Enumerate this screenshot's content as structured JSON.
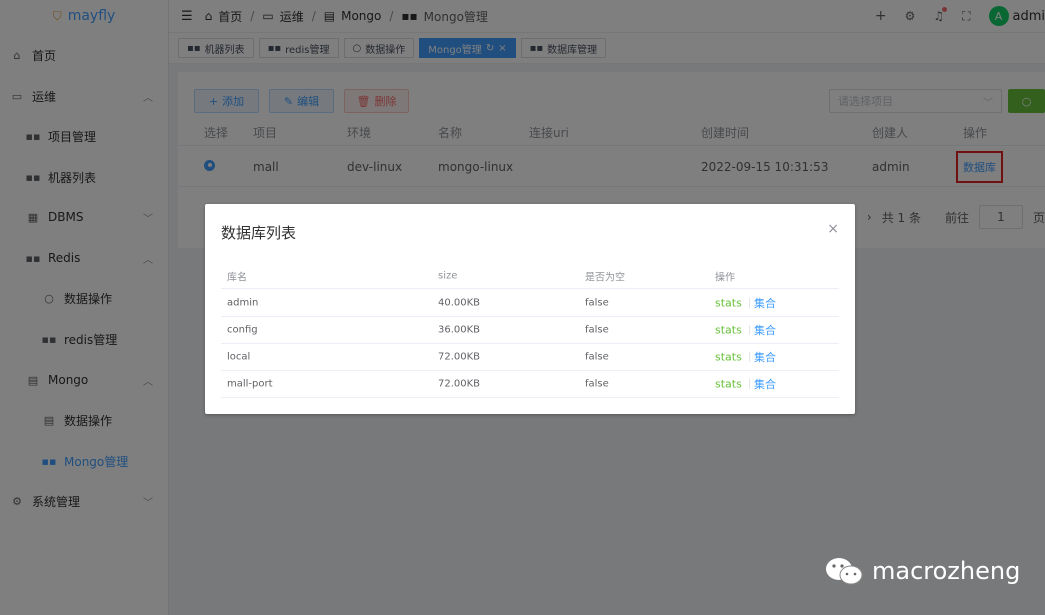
{
  "app": {
    "name": "mayfly"
  },
  "sidebar": {
    "items": [
      {
        "label": "首页",
        "icon": "home-icon"
      },
      {
        "label": "运维",
        "icon": "monitor-icon"
      },
      {
        "label": "项目管理",
        "icon": "grid-icon"
      },
      {
        "label": "机器列表",
        "icon": "grid-icon"
      },
      {
        "label": "DBMS",
        "icon": "table-icon"
      },
      {
        "label": "Redis",
        "icon": "grid-icon"
      },
      {
        "label": "数据操作",
        "icon": "search-icon"
      },
      {
        "label": "redis管理",
        "icon": "grid-icon"
      },
      {
        "label": "Mongo",
        "icon": "document-icon"
      },
      {
        "label": "数据操作",
        "icon": "document-icon"
      },
      {
        "label": "Mongo管理",
        "icon": "grid-icon"
      },
      {
        "label": "系统管理",
        "icon": "gear-icon"
      }
    ]
  },
  "breadcrumb": {
    "home": "首页",
    "ops": "运维",
    "mongo": "Mongo",
    "current": "Mongo管理"
  },
  "header": {
    "user": "admi",
    "avatar_letter": "A"
  },
  "tags": [
    {
      "label": "机器列表"
    },
    {
      "label": "redis管理"
    },
    {
      "label": "数据操作"
    },
    {
      "label": "Mongo管理"
    },
    {
      "label": "数据库管理"
    }
  ],
  "toolbar": {
    "add": "添加",
    "edit": "编辑",
    "delete": "删除",
    "select_placeholder": "请选择项目"
  },
  "table": {
    "headers": [
      "选择",
      "项目",
      "环境",
      "名称",
      "连接uri",
      "创建时间",
      "创建人",
      "操作"
    ],
    "rows": [
      {
        "project": "mall",
        "env": "dev-linux",
        "name": "mongo-linux",
        "uri": "",
        "created": "2022-09-15 10:31:53",
        "creator": "admin",
        "action": "数据库"
      }
    ]
  },
  "pagination": {
    "total": "共 1 条",
    "goto": "前往",
    "page": "1",
    "page_suffix": "页"
  },
  "modal": {
    "title": "数据库列表",
    "headers": [
      "库名",
      "size",
      "是否为空",
      "操作"
    ],
    "rows": [
      {
        "name": "admin",
        "size": "40.00KB",
        "empty": "false",
        "stats": "stats",
        "coll": "集合"
      },
      {
        "name": "config",
        "size": "36.00KB",
        "empty": "false",
        "stats": "stats",
        "coll": "集合"
      },
      {
        "name": "local",
        "size": "72.00KB",
        "empty": "false",
        "stats": "stats",
        "coll": "集合"
      },
      {
        "name": "mall-port",
        "size": "72.00KB",
        "empty": "false",
        "stats": "stats",
        "coll": "集合"
      }
    ]
  },
  "watermark": "macrozheng",
  "colors": {
    "primary": "#409eff",
    "success": "#67c23a",
    "danger": "#f56c6c",
    "highlight_border": "#e02020"
  }
}
